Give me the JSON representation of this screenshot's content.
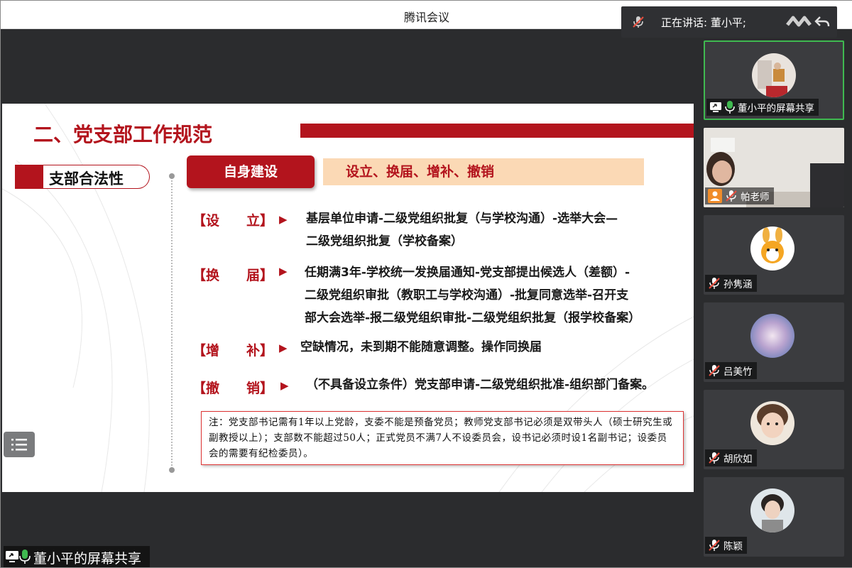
{
  "app": {
    "title": "腾讯会议"
  },
  "speaking": {
    "text": "正在讲话: 董小平;"
  },
  "slide": {
    "title": "二、党支部工作规范",
    "section_label": "支部合法性",
    "tab_active": "自身建设",
    "tab_subtitle": "设立、换届、增补、撤销",
    "rows": [
      {
        "label": "【设　　立】",
        "lines": [
          "基层单位申请-二级党组织批复（与学校沟通）-选举大会—",
          "二级党组织批复（学校备案）"
        ]
      },
      {
        "label": "【换　　届】",
        "lines": [
          "任期满3年-学校统一发换届通知-党支部提出候选人（差额）-",
          "二级党组织审批（教职工与学校沟通）-批复同意选举-召开支",
          "部大会选举-报二级党组织审批-二级党组织批复（报学校备案）"
        ]
      },
      {
        "label": "【增　　补】",
        "lines": [
          "空缺情况，未到期不能随意调整。操作同换届"
        ]
      },
      {
        "label": "【撤　　销】",
        "lines": [
          "（不具备设立条件）党支部申请-二级党组织批准-组织部门备案。"
        ]
      }
    ],
    "note": "注：党支部书记需有1年以上党龄，支委不能是预备党员；教师党支部书记必须是双带头人（硕士研究生或副教授以上）；支部数不能超过50人；正式党员不满7人不设委员会，设书记必须时设1名副书记；设委员会的需要有纪检委员）。"
  },
  "share_tag": {
    "text": "董小平的屏幕共享"
  },
  "participants": [
    {
      "name": "董小平的屏幕共享",
      "status": "speaking-sharing",
      "active": true
    },
    {
      "name": "帕老师",
      "status": "muted-video"
    },
    {
      "name": "孙隽涵",
      "status": "muted"
    },
    {
      "name": "吕美竹",
      "status": "muted"
    },
    {
      "name": "胡欣如",
      "status": "muted"
    },
    {
      "name": "陈颖",
      "status": "muted"
    }
  ],
  "colors": {
    "accent_red": "#b3141d",
    "peach": "#fbd9b5",
    "active_green": "#3fb950",
    "bg_dark": "#2b2c2e"
  }
}
